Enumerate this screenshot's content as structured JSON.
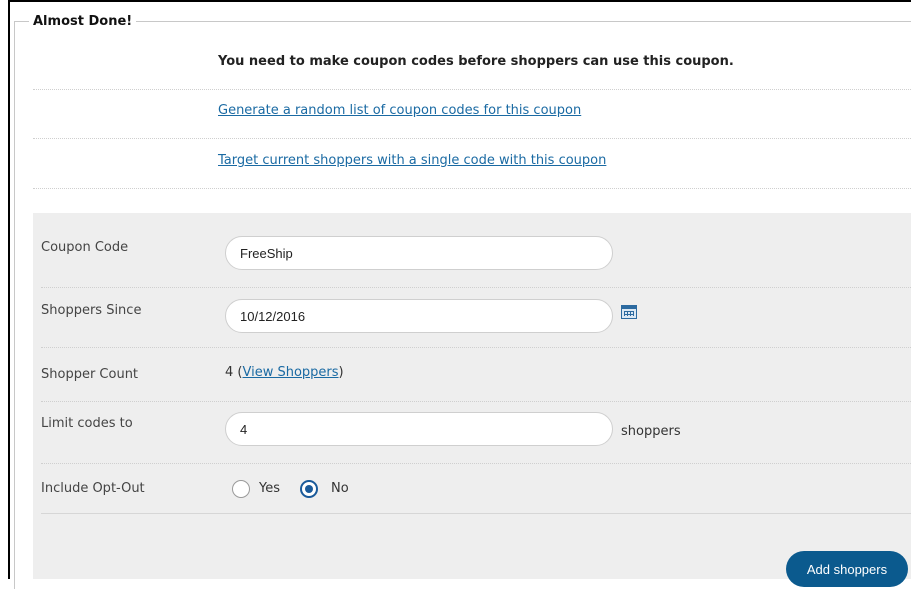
{
  "section": {
    "title": "Almost Done!",
    "message": "You need to make coupon codes before shoppers can use this coupon.",
    "links": [
      "Generate a random list of coupon codes for this coupon",
      "Target current shoppers with a single code with this coupon"
    ]
  },
  "form": {
    "coupon_code": {
      "label": "Coupon Code",
      "value": "FreeShip"
    },
    "shoppers_since": {
      "label": "Shoppers Since",
      "value": "10/12/2016"
    },
    "shopper_count": {
      "label": "Shopper Count",
      "count": "4",
      "open_paren": " (",
      "link": "View Shoppers",
      "close_paren": ")"
    },
    "limit_codes": {
      "label": "Limit codes to",
      "value": "4",
      "suffix": "shoppers"
    },
    "include_opt_out": {
      "label": "Include Opt-Out",
      "options": [
        "Yes",
        "No"
      ],
      "selected": "No"
    },
    "submit_label": "Add shoppers"
  },
  "colors": {
    "accent": "#0b5a8e",
    "link": "#1a6aa3",
    "panel": "#eeeeee"
  }
}
